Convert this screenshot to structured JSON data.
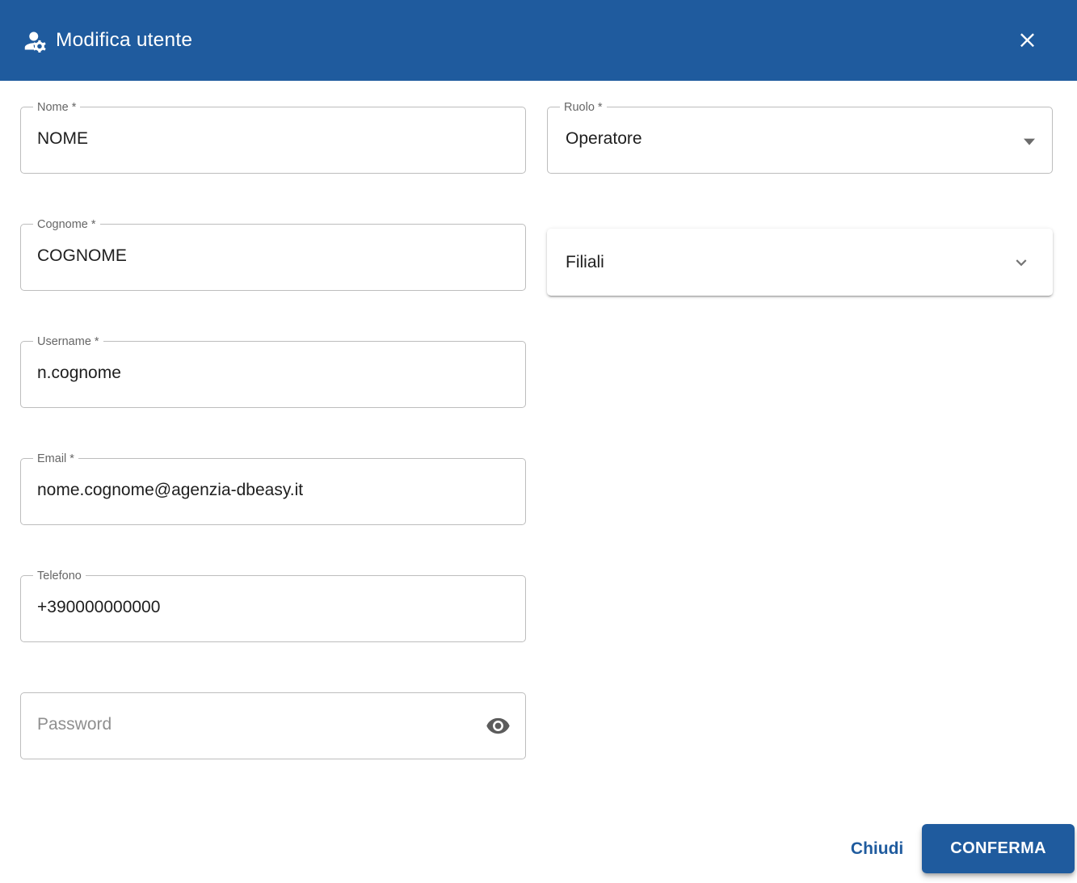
{
  "header": {
    "title": "Modifica utente",
    "icon": "manage-accounts-icon",
    "close_icon": "close-icon"
  },
  "form": {
    "fields": [
      {
        "id": "nome",
        "label": "Nome *",
        "value": "NOME"
      },
      {
        "id": "cognome",
        "label": "Cognome *",
        "value": "COGNOME"
      },
      {
        "id": "username",
        "label": "Username *",
        "value": "n.cognome"
      },
      {
        "id": "email",
        "label": "Email *",
        "value": "nome.cognome@agenzia-dbeasy.it"
      },
      {
        "id": "telefono",
        "label": "Telefono",
        "value": "+390000000000"
      },
      {
        "id": "password",
        "placeholder": "Password",
        "value": "",
        "icon": "visibility-eye-icon"
      }
    ],
    "ruolo": {
      "label": "Ruolo *",
      "value": "Operatore",
      "icon": "dropdown-arrow-icon"
    },
    "filiali": {
      "label": "Filiali",
      "icon": "chevron-down-icon"
    }
  },
  "footer": {
    "close_label": "Chiudi",
    "confirm_label": "CONFERMA"
  },
  "colors": {
    "primary": "#1f5b9e",
    "field_border": "#bdbdbd",
    "label_gray": "#666666",
    "text_dark": "#1e1e1e"
  }
}
